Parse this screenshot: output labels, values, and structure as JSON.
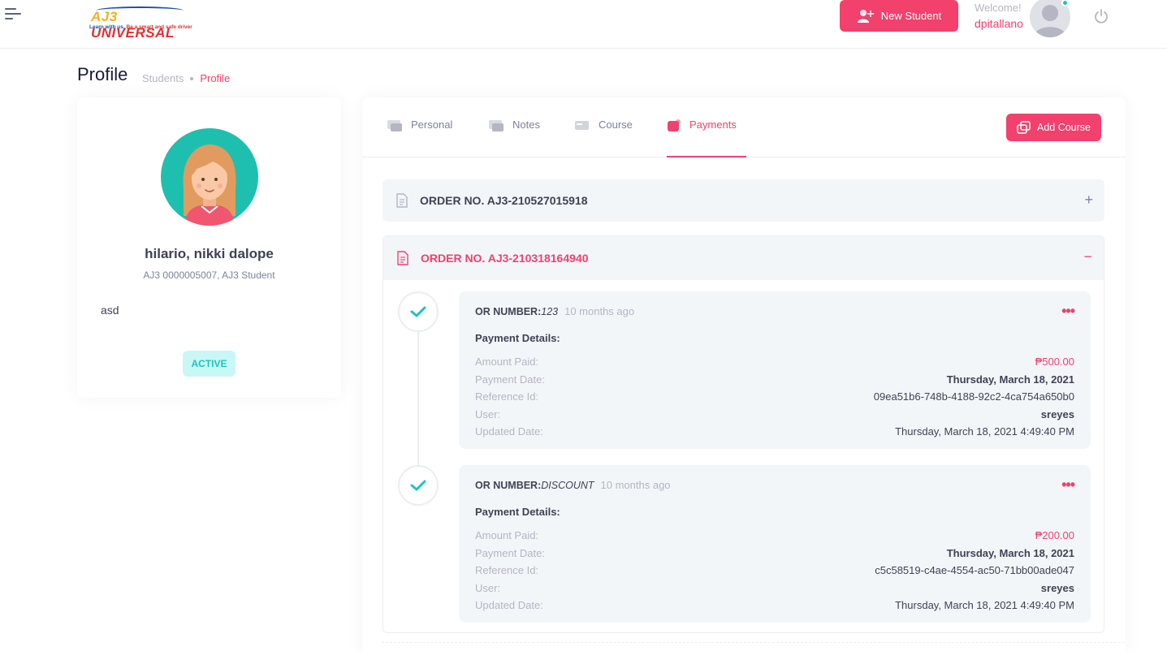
{
  "header": {
    "logo_title_a": "AJ3",
    "logo_title_b": " UNIVERSAL",
    "logo_tagline_a": "Learn with us, ",
    "logo_tagline_b": "Be a smart",
    "logo_tagline_c": " and safe driver",
    "new_student_label": "New Student",
    "welcome_text": "Welcome!",
    "username": "dpitallano"
  },
  "page": {
    "title": "Profile",
    "breadcrumb": [
      "Students",
      "Profile"
    ]
  },
  "profile": {
    "name": "hilario, nikki dalope",
    "subtitle": "AJ3 0000005007, AJ3 Student",
    "note": "asd",
    "status": "ACTIVE"
  },
  "tabs": [
    {
      "label": "Personal",
      "icon": "id-card-icon"
    },
    {
      "label": "Notes",
      "icon": "notes-icon"
    },
    {
      "label": "Course",
      "icon": "course-icon"
    },
    {
      "label": "Payments",
      "icon": "payments-icon",
      "active": true
    }
  ],
  "add_course_label": "Add Course",
  "orders": [
    {
      "label": "ORDER NO. AJ3-210527015918",
      "expanded": false,
      "toggle": "+"
    },
    {
      "label": "ORDER NO. AJ3-210318164940",
      "expanded": true,
      "toggle": "−"
    }
  ],
  "payments": [
    {
      "or_label": "OR NUMBER:",
      "or_value": "123",
      "ago": "10 months ago",
      "details_title": "Payment Details:",
      "rows": [
        {
          "label": "Amount Paid:",
          "value": "₱500.00"
        },
        {
          "label": "Payment Date:",
          "value": "Thursday, March 18, 2021"
        },
        {
          "label": "Reference Id:",
          "value": "09ea51b6-748b-4188-92c2-4ca754a650b0"
        },
        {
          "label": "User:",
          "value": "sreyes"
        },
        {
          "label": "Updated Date:",
          "value": "Thursday, March 18, 2021 4:49:40 PM"
        }
      ]
    },
    {
      "or_label": "OR NUMBER:",
      "or_value": "DISCOUNT",
      "ago": "10 months ago",
      "details_title": "Payment Details:",
      "rows": [
        {
          "label": "Amount Paid:",
          "value": "₱200.00"
        },
        {
          "label": "Payment Date:",
          "value": "Thursday, March 18, 2021"
        },
        {
          "label": "Reference Id:",
          "value": "c5c58519-c4ae-4554-ac50-71bb00ade047"
        },
        {
          "label": "User:",
          "value": "sreyes"
        },
        {
          "label": "Updated Date:",
          "value": "Thursday, March 18, 2021 4:49:40 PM"
        }
      ]
    }
  ],
  "colors": {
    "accent": "#f1416c",
    "teal": "#1bc5bd",
    "muted": "#b5b5c3"
  }
}
